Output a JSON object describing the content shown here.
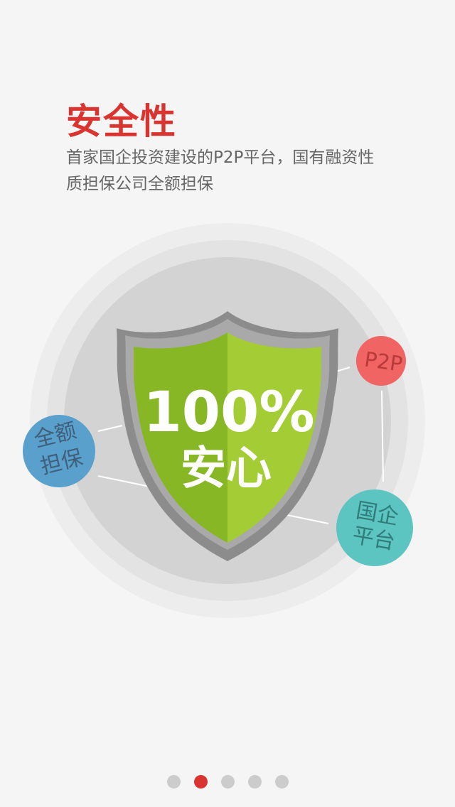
{
  "header": {
    "title": "安全性",
    "description_line1": "首家国企投资建设的P2P平台，国有融资性",
    "description_line2": "质担保公司全额担保"
  },
  "shield": {
    "percent_text": "100%",
    "caption": "安心",
    "color_left": "#87b724",
    "color_right": "#a3cc35"
  },
  "badges": {
    "guarantee": {
      "line1": "全额",
      "line2": "担保",
      "color": "#5aa0cc"
    },
    "p2p": {
      "text": "P2P",
      "color": "#f06464"
    },
    "state_platform": {
      "line1": "国企",
      "line2": "平台",
      "color": "#5cc5c2"
    }
  },
  "pager": {
    "count": 5,
    "active_index": 1,
    "active_color": "#d9342f",
    "inactive_color": "#cccccc"
  }
}
